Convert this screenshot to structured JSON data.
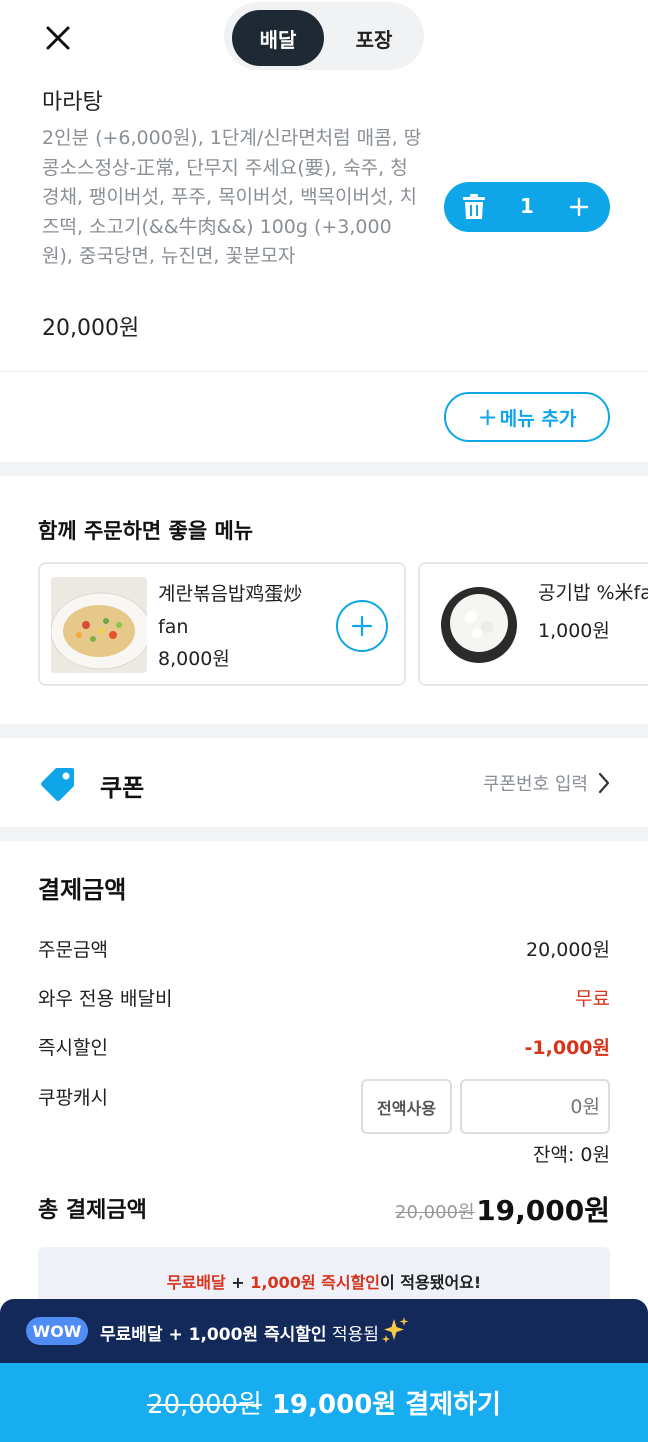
{
  "header": {
    "tabs": [
      {
        "label": "배달",
        "selected": true
      },
      {
        "label": "포장",
        "selected": false
      }
    ]
  },
  "cart_item": {
    "name": "마라탕",
    "options": "2인분 (+6,000원), 1단계/신라면처럼 매콤, 땅콩소스정상-正常, 단무지 주세요(要), 숙주, 청경채, 팽이버섯, 푸주, 목이버섯, 백목이버섯, 치즈떡, 소고기(&&牛肉&&) 100g (+3,000원), 중국당면, 뉴진면, 꽃분모자",
    "price": "20,000원",
    "quantity": "1"
  },
  "add_menu_label": "메뉴 추가",
  "recommend": {
    "title": "함께 주문하면 좋을 메뉴",
    "items": [
      {
        "name": "계란볶음밥鸡蛋炒fan",
        "price": "8,000원"
      },
      {
        "name": "공기밥 %米fan",
        "price": "1,000원"
      }
    ]
  },
  "coupon": {
    "label": "쿠폰",
    "action": "쿠폰번호 입력"
  },
  "payment": {
    "title": "결제금액",
    "order_label": "주문금액",
    "order_value": "20,000원",
    "delivery_label": "와우 전용 배달비",
    "delivery_value": "무료",
    "discount_label": "즉시할인",
    "discount_value": "-1,000원",
    "cash_label": "쿠팡캐시",
    "cash_all_button": "전액사용",
    "cash_input_placeholder": "0원",
    "balance": "잔액: 0원",
    "total_label": "총 결제금액",
    "total_original": "20,000원",
    "total_final": "19,000원"
  },
  "notice": {
    "part1": "무료배달",
    "part2": " + ",
    "part3": "1,000원 즉시할인",
    "part4": "이 적용됐어요!"
  },
  "wow_banner": {
    "badge": "WOW",
    "text_bold": "무료배달 + 1,000원 즉시할인",
    "text_normal": " 적용됨"
  },
  "checkout": {
    "original": "20,000원",
    "label": "19,000원 결제하기"
  },
  "colors": {
    "accent": "#0ea5e9",
    "discount_red": "#d8331c",
    "wow_navy": "#13295a",
    "checkout_blue": "#18acf1"
  }
}
